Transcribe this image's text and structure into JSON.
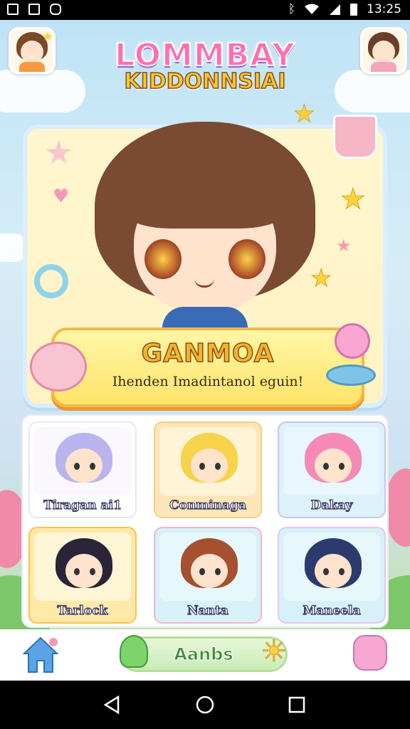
{
  "status_bar": {
    "time": "13:25"
  },
  "header": {
    "logo_line1": "LOMMBAY",
    "logo_line2": "KIDDONNSIAI"
  },
  "featured": {
    "title": "GANMOA",
    "subtitle": "Ihenden Imadintanol eguin!"
  },
  "characters": [
    {
      "name": "Tiragan ai1",
      "hair": "#b9b4ee",
      "bg": "#ffffff",
      "border": "#e4e8f4"
    },
    {
      "name": "Conminaga",
      "hair": "#f6d34a",
      "bg": "#ffe6b8",
      "border": "#f5cf82"
    },
    {
      "name": "Dakay",
      "hair": "#f58ab7",
      "bg": "#dcf2fb",
      "border": "#c9c4ef"
    },
    {
      "name": "Tarlock",
      "hair": "#2a2438",
      "bg": "#ffe9a8",
      "border": "#f6c44a"
    },
    {
      "name": "Nanta",
      "hair": "#a5502e",
      "bg": "#d6f1f7",
      "border": "#f3b4cc"
    },
    {
      "name": "Maneela",
      "hair": "#2d3a6e",
      "bg": "#d6f1f7",
      "border": "#e6c6ee"
    }
  ],
  "bottom_nav": {
    "center_label": "Aanbs"
  },
  "icons": {
    "home": "home-icon",
    "profile": "profile-icon",
    "back": "back-icon",
    "circle": "home-circle-icon",
    "recents": "recents-icon"
  }
}
